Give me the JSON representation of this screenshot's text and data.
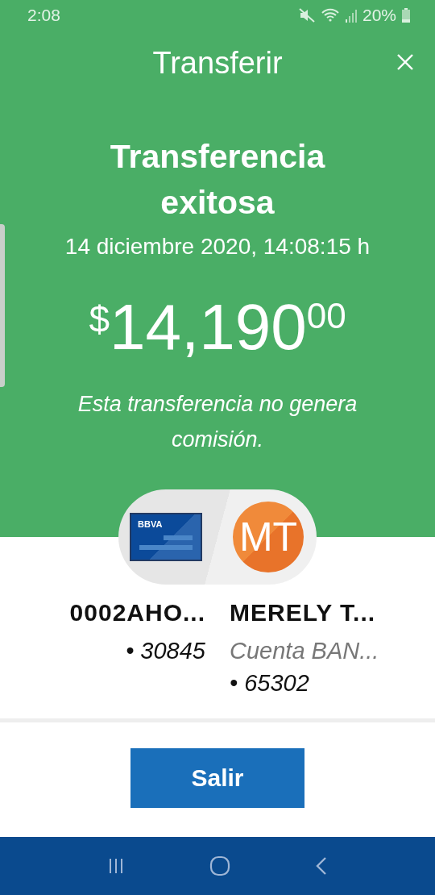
{
  "status_bar": {
    "time": "2:08",
    "battery": "20%"
  },
  "header": {
    "title": "Transferir"
  },
  "result": {
    "title": "Transferencia exitosa",
    "date": "14 diciembre 2020, 14:08:15 h",
    "amount": {
      "currency": "$",
      "whole": "14,190",
      "cents": "00"
    },
    "note": "Esta transferencia no genera comisión."
  },
  "origin": {
    "bank_logo": "BBVA",
    "name": "0002AHO...",
    "account": "• 30845"
  },
  "destination": {
    "initials": "MT",
    "name": "MERELY T...",
    "account_type": "Cuenta BAN...",
    "account": "• 65302"
  },
  "buttons": [
    {
      "label": "Salir"
    }
  ]
}
